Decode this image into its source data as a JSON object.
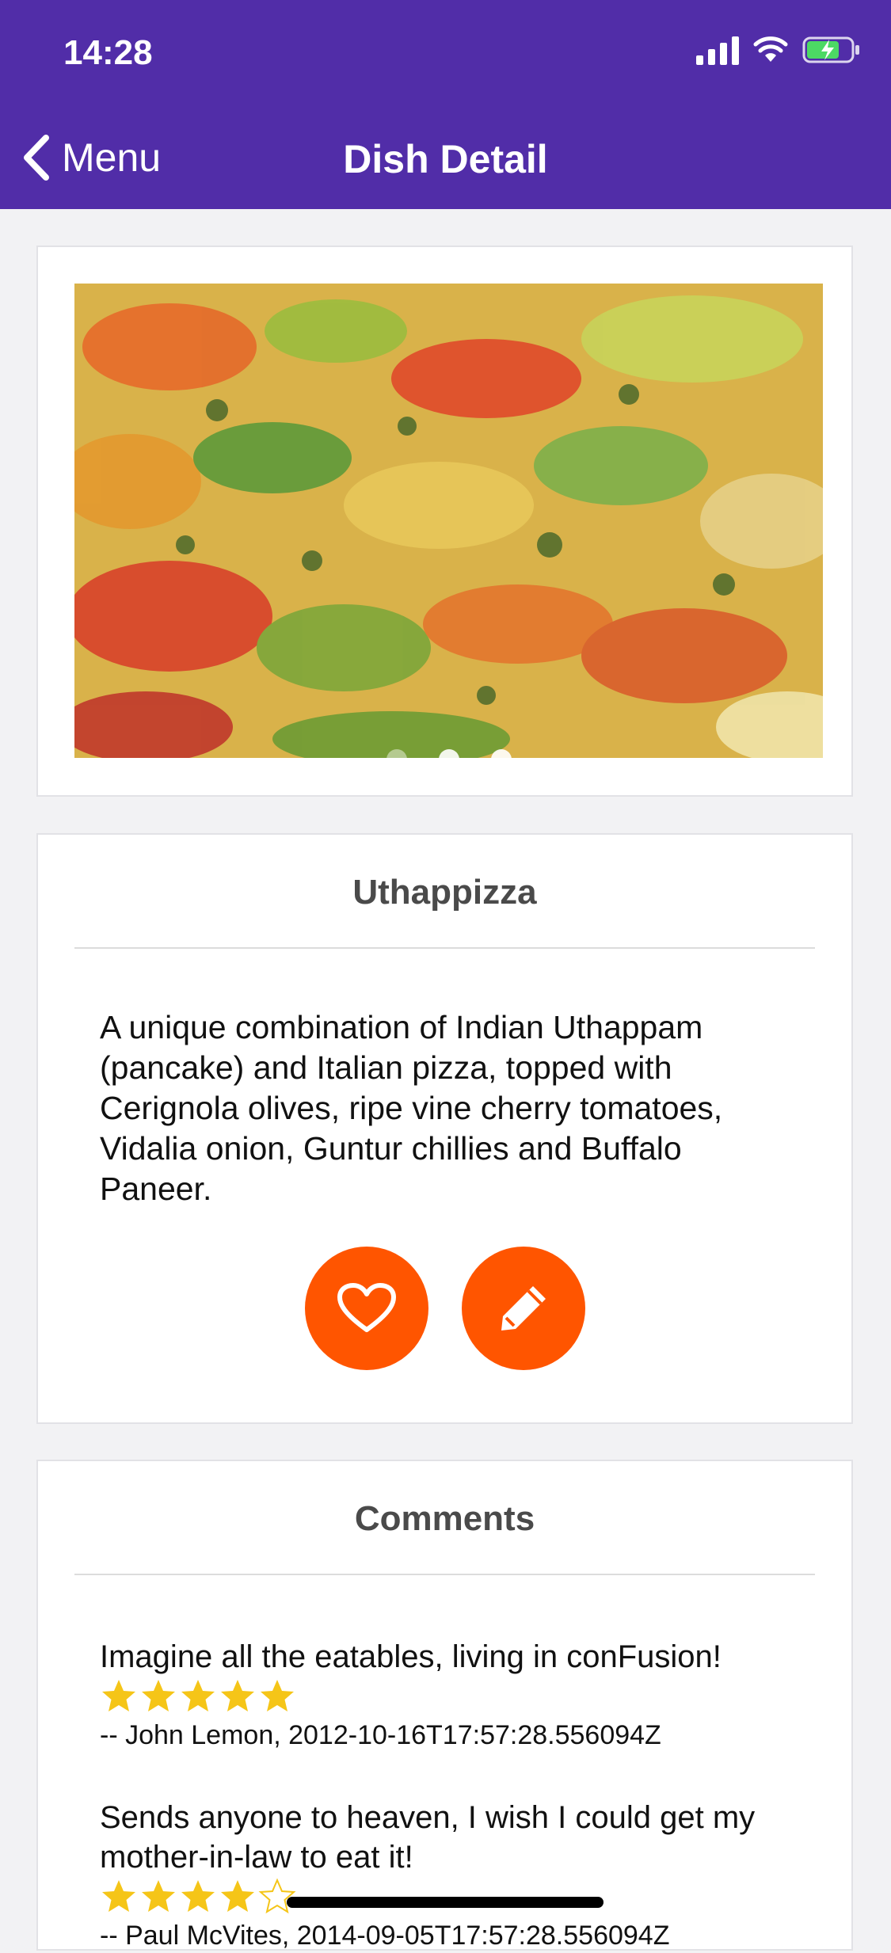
{
  "status_bar": {
    "time": "14:28"
  },
  "nav": {
    "back_label": "Menu",
    "title": "Dish Detail"
  },
  "carousel": {
    "dots": 3,
    "active_dot": 0
  },
  "dish": {
    "name": "Uthappizza",
    "description": "A unique combination of Indian Uthappam (pancake) and Italian pizza, topped with Cerignola olives, ripe vine cherry tomatoes, Vidalia onion, Guntur chillies and Buffalo Paneer."
  },
  "actions": {
    "favorite_icon": "heart-icon",
    "comment_icon": "pencil-icon"
  },
  "comments_section": {
    "title": "Comments",
    "items": [
      {
        "text": "Imagine all the eatables, living in conFusion!",
        "rating": 5,
        "byline": "-- John Lemon, 2012-10-16T17:57:28.556094Z"
      },
      {
        "text": "Sends anyone to heaven, I wish I could get my mother-in-law to eat it!",
        "rating": 4,
        "byline": "-- Paul McVites, 2014-09-05T17:57:28.556094Z"
      }
    ]
  },
  "colors": {
    "primary": "#512da8",
    "accent": "#ff5500",
    "star": "#f5c518"
  }
}
